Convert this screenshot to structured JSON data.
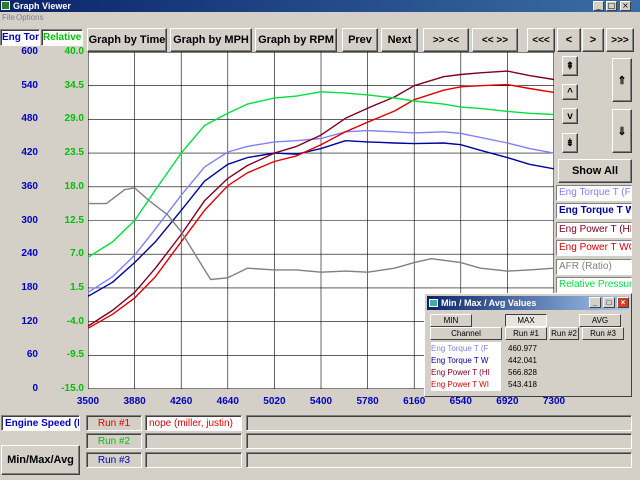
{
  "window": {
    "title": "Graph Viewer",
    "minimize": "_",
    "maximize": "□",
    "close": "×"
  },
  "menu": {
    "file": "File",
    "options": "Options"
  },
  "toolbar": {
    "graph_time": "Graph by Time",
    "graph_mph": "Graph by MPH",
    "graph_rpm": "Graph by RPM",
    "prev": "Prev",
    "next": "Next",
    "zoom_in": ">> <<",
    "zoom_out": "<< >>",
    "first": "<<<",
    "left": "<",
    "right": ">",
    "last": ">>>"
  },
  "side_controls": {
    "scroll_up_fast": "⇞",
    "scroll_up": "^",
    "scroll_down": "v",
    "scroll_down_fast": "⇟",
    "show_all": "Show All",
    "expand_up": "⇑",
    "expand_down": "⇓"
  },
  "axes": {
    "left_title": "Eng Torq",
    "right_title": "Relative",
    "left_ticks": [
      "600",
      "540",
      "480",
      "420",
      "360",
      "300",
      "240",
      "180",
      "120",
      "60",
      "0"
    ],
    "right_ticks": [
      "40.0",
      "34.5",
      "29.0",
      "23.5",
      "18.0",
      "12.5",
      "7.0",
      "1.5",
      "-4.0",
      "-9.5",
      "-15.0"
    ],
    "bottom_ticks": [
      "3500",
      "3880",
      "4260",
      "4640",
      "5020",
      "5400",
      "5780",
      "6160",
      "6540",
      "6920",
      "7300"
    ],
    "x_channel": "Engine Speed (R"
  },
  "colors": {
    "torque_fw": "#8080ff",
    "torque_w": "#0000a0",
    "power_hi": "#800020",
    "power_wc": "#e00000",
    "afr": "#808080",
    "rel_pressure": "#00e040",
    "grid": "#000000"
  },
  "legend": [
    {
      "label": "Eng Torque T (F",
      "color": "#8080ff"
    },
    {
      "label": "Eng Torque T W",
      "color": "#0000a0"
    },
    {
      "label": "Eng Power T (HF",
      "color": "#800020"
    },
    {
      "label": "Eng Power T WC",
      "color": "#e00000"
    },
    {
      "label": "AFR (Ratio)",
      "color": "#808080"
    },
    {
      "label": "Relative Pressur",
      "color": "#00e040"
    }
  ],
  "runs": {
    "run1_label": "Run #1",
    "run1_name": "nope (miller, justin)",
    "run2_label": "Run #2",
    "run3_label": "Run #3",
    "minmax_button": "Min/Max/Avg"
  },
  "popup": {
    "title": "Min / Max / Avg Values",
    "min": "MIN",
    "max": "MAX",
    "avg": "AVG",
    "col_channel": "Channel",
    "col_run1": "Run #1",
    "col_run2": "Run #2",
    "col_run3": "Run #3",
    "rows": [
      {
        "name": "Eng Torque T (F",
        "run1": "460.977",
        "color": "#8080ff"
      },
      {
        "name": "Eng Torque T W",
        "run1": "442.041",
        "color": "#0000a0"
      },
      {
        "name": "Eng Power T (HI",
        "run1": "566.828",
        "color": "#800020"
      },
      {
        "name": "Eng Power T WI",
        "run1": "543.418",
        "color": "#e00000"
      }
    ]
  },
  "chart_data": {
    "type": "line",
    "xlabel": "Engine Speed (R",
    "ylabel": "Eng Torq",
    "y2label": "Relative",
    "xlim": [
      3500,
      7300
    ],
    "ylim": [
      0,
      600
    ],
    "y2lim": [
      -15,
      40
    ],
    "grid": true,
    "legend_position": "right",
    "series": [
      {
        "name": "Eng Torque T (F",
        "axis": "left",
        "color": "#8080ff",
        "x": [
          3500,
          3700,
          3880,
          4050,
          4260,
          4450,
          4640,
          4800,
          5020,
          5200,
          5400,
          5600,
          5780,
          6000,
          6160,
          6400,
          6540,
          6700,
          6920,
          7100,
          7300
        ],
        "y": [
          172,
          200,
          238,
          285,
          345,
          395,
          422,
          432,
          440,
          442,
          446,
          458,
          460,
          458,
          456,
          458,
          455,
          448,
          438,
          428,
          420
        ]
      },
      {
        "name": "Eng Torque T W",
        "axis": "left",
        "color": "#0000a0",
        "x": [
          3500,
          3700,
          3880,
          4050,
          4260,
          4450,
          4640,
          4800,
          5020,
          5200,
          5400,
          5600,
          5780,
          6000,
          6160,
          6400,
          6540,
          6700,
          6920,
          7100,
          7300
        ],
        "y": [
          165,
          190,
          225,
          262,
          318,
          370,
          400,
          412,
          420,
          418,
          428,
          442,
          440,
          438,
          437,
          438,
          435,
          425,
          412,
          400,
          392
        ]
      },
      {
        "name": "Eng Power T (HF",
        "axis": "left",
        "color": "#800020",
        "x": [
          3500,
          3700,
          3880,
          4050,
          4260,
          4450,
          4640,
          4800,
          5020,
          5200,
          5400,
          5600,
          5780,
          6000,
          6160,
          6400,
          6540,
          6700,
          6920,
          7100,
          7300
        ],
        "y": [
          112,
          140,
          172,
          215,
          275,
          335,
          375,
          398,
          420,
          432,
          452,
          482,
          500,
          520,
          540,
          556,
          560,
          563,
          566,
          558,
          551
        ]
      },
      {
        "name": "Eng Power T WC",
        "axis": "left",
        "color": "#e00000",
        "x": [
          3500,
          3700,
          3880,
          4050,
          4260,
          4450,
          4640,
          4800,
          5020,
          5200,
          5400,
          5600,
          5780,
          6000,
          6160,
          6400,
          6540,
          6700,
          6920,
          7100,
          7300
        ],
        "y": [
          108,
          133,
          162,
          200,
          262,
          318,
          362,
          385,
          405,
          415,
          435,
          458,
          475,
          495,
          515,
          532,
          538,
          540,
          542,
          535,
          528
        ]
      },
      {
        "name": "AFR (Ratio)",
        "axis": "left",
        "color": "#808080",
        "x": [
          3500,
          3650,
          3800,
          3880,
          4000,
          4150,
          4260,
          4400,
          4500,
          4640,
          4800,
          5020,
          5200,
          5400,
          5600,
          5780,
          6000,
          6160,
          6300,
          6540,
          6700,
          6920,
          7100,
          7300
        ],
        "y": [
          330,
          330,
          355,
          358,
          335,
          310,
          280,
          230,
          195,
          198,
          215,
          212,
          212,
          208,
          210,
          208,
          215,
          225,
          232,
          225,
          215,
          210,
          212,
          215
        ]
      },
      {
        "name": "Relative Pressur",
        "axis": "right",
        "color": "#00e040",
        "x": [
          3500,
          3700,
          3880,
          4050,
          4260,
          4450,
          4640,
          4800,
          5020,
          5200,
          5400,
          5600,
          5780,
          6000,
          6160,
          6400,
          6540,
          6700,
          6920,
          7100,
          7300
        ],
        "y": [
          6.5,
          9.0,
          12.5,
          17.5,
          23.5,
          28.0,
          30.0,
          31.5,
          32.5,
          32.8,
          33.5,
          33.3,
          33.0,
          32.5,
          32.0,
          31.5,
          31.0,
          30.8,
          30.3,
          30.0,
          29.8
        ]
      }
    ]
  }
}
